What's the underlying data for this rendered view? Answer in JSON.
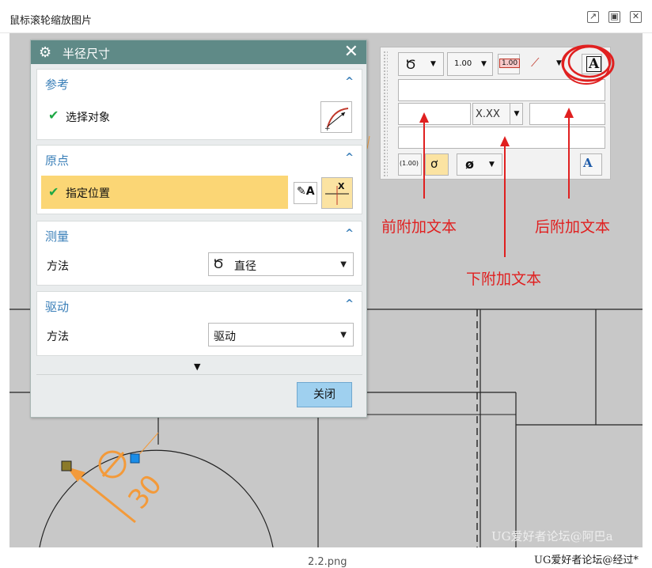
{
  "window": {
    "title": "鼠标滚轮缩放图片",
    "filename": "2.2.png",
    "controls": [
      "popout-icon",
      "maximize-icon",
      "close-icon"
    ]
  },
  "dialog": {
    "title": "半径尺寸",
    "sections": {
      "reference": {
        "title": "参考",
        "item_label": "选择对象"
      },
      "origin": {
        "title": "原点",
        "item_label": "指定位置"
      },
      "measure": {
        "title": "测量",
        "method_label": "方法",
        "method_value": "直径"
      },
      "drive": {
        "title": "驱动",
        "method_label": "方法",
        "method_value": "驱动"
      }
    },
    "close_button": "关闭",
    "accent_color": "#5f8a87",
    "highlight_color": "#fbd675"
  },
  "toolbar": {
    "precision_value": "1.00",
    "precision_badge": "1.00",
    "tolerance_format": "X.XX",
    "paren_value": "(1.00)",
    "diameter_symbol": "ø"
  },
  "annotations": {
    "prefix_text": "前附加文本",
    "suffix_text": "后附加文本",
    "below_text": "下附加文本",
    "color": "#e02020"
  },
  "drawing": {
    "dimension_value": "30",
    "diameter_symbol": "Φ"
  },
  "watermarks": {
    "line1": "UG爱好者论坛@阿巴a",
    "line2": "UG爱好者论坛@经过*"
  }
}
